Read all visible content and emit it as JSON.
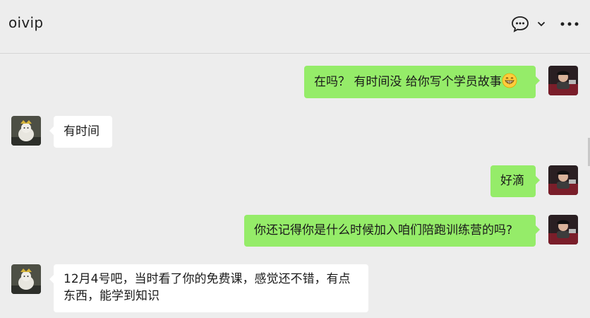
{
  "header": {
    "title": "oivip",
    "chat_icon": "chat-bubble-icon",
    "dropdown_icon": "chevron-down-icon",
    "more_icon": "more-dots-icon"
  },
  "messages": [
    {
      "sender": "me",
      "text": "在吗？ 有时间没 给你写个学员故事",
      "emoji": "grinning-face-icon"
    },
    {
      "sender": "them",
      "text": "有时间"
    },
    {
      "sender": "me",
      "text": "好滴"
    },
    {
      "sender": "me",
      "text": "你还记得你是什么时候加入咱们陪跑训练营的吗?"
    },
    {
      "sender": "them",
      "text": "12月4号吧，当时看了你的免费课，感觉还不错，有点东西，能学到知识"
    }
  ],
  "colors": {
    "background": "#ededed",
    "my_bubble": "#95ec69",
    "their_bubble": "#ffffff"
  }
}
